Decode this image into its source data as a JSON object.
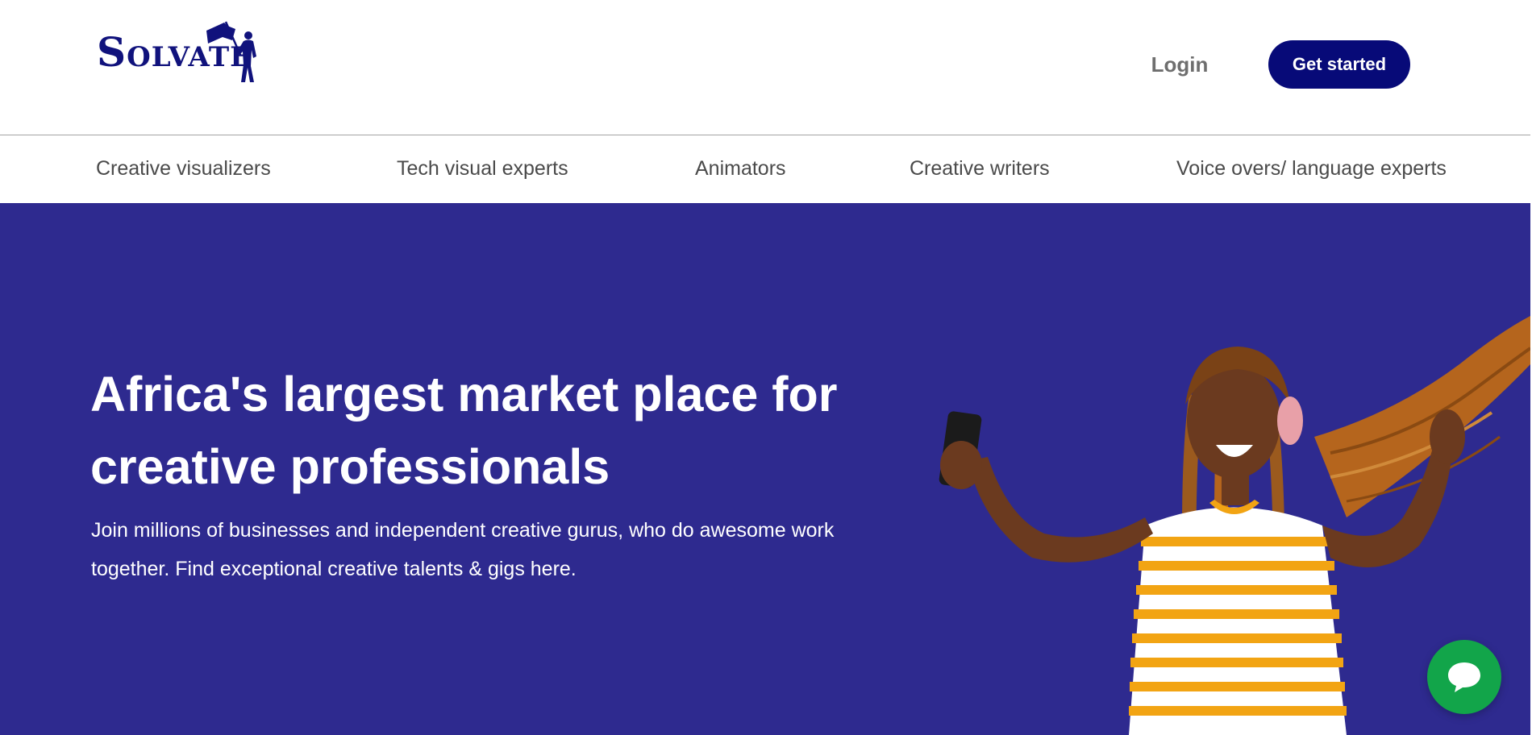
{
  "header": {
    "logo_text": "Solvate",
    "login_label": "Login",
    "cta_label": "Get started"
  },
  "categories": [
    "Creative visualizers",
    "Tech visual experts",
    "Animators",
    "Creative writers",
    "Voice overs/ language experts"
  ],
  "hero": {
    "title": "Africa's largest market place for creative professionals",
    "subtitle": "Join millions of businesses and independent creative gurus, who do awesome work together. Find exceptional creative talents & gigs here."
  },
  "icons": {
    "chat": "chat-bubble-icon",
    "logo_figure": "flag-bearer-icon"
  },
  "colors": {
    "brand": "#070a78",
    "hero_bg": "#2e2a8f",
    "chat": "#12a54a",
    "nav_text": "#4a4a4a"
  }
}
